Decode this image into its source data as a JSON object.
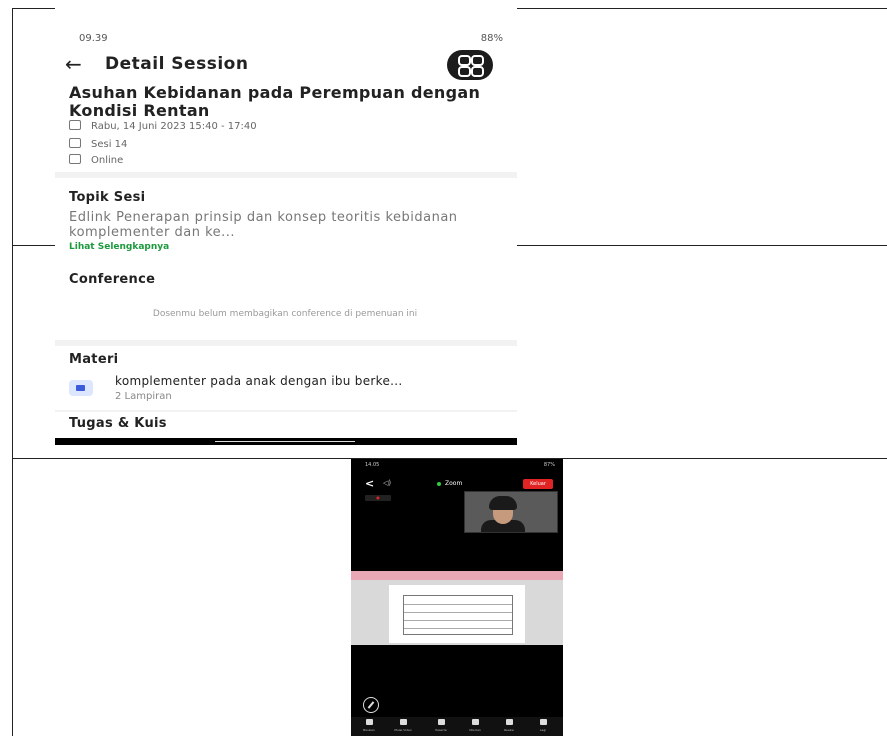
{
  "session_screen": {
    "status_time": "09.39",
    "status_right": "88%",
    "header_title": "Detail Session",
    "title": "Asuhan Kebidanan pada Perempuan dengan Kondisi Rentan",
    "date": "Rabu, 14 Juni 2023 15:40 - 17:40",
    "session": "Sesi 14",
    "mode": "Online",
    "topik_heading": "Topik Sesi",
    "topik_text": "Edlink Penerapan prinsip dan konsep teoritis kebidanan komplementer dan ke...",
    "more_link": "Lihat Selengkapnya",
    "conference_heading": "Conference",
    "conference_empty": "Dosenmu belum membagikan conference di pemenuan ini",
    "materi_heading": "Materi",
    "materi_item_title": "komplementer pada anak dengan ibu berke...",
    "materi_item_sub": "2 Lampiran",
    "tugas_heading": "Tugas & Kuis"
  },
  "zoom_screen": {
    "status_time": "14.05",
    "status_right": "87%",
    "title": "Zoom",
    "leave_label": "Keluar",
    "tabs": [
      "Bisukan",
      "Mulai Video",
      "Peserta",
      "Obrolan",
      "Reaksi",
      "Lagi"
    ]
  }
}
